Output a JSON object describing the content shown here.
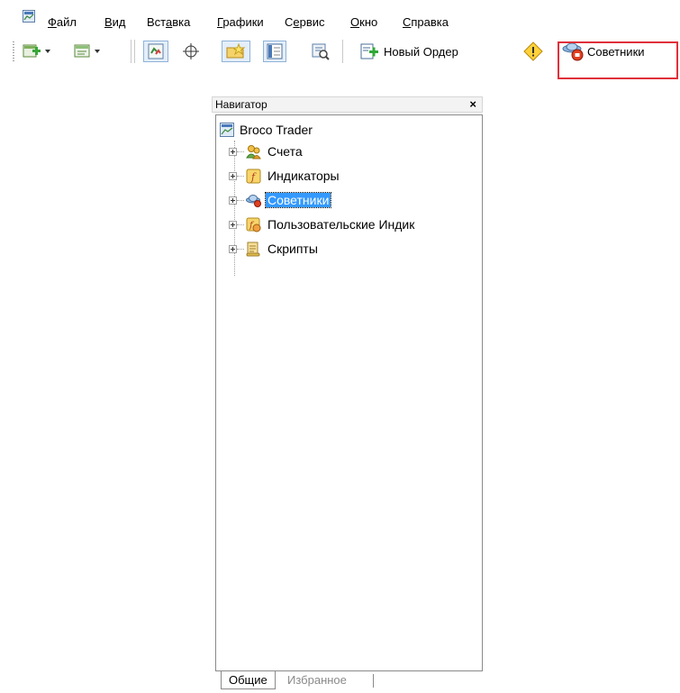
{
  "menu": {
    "items": [
      {
        "label": "Файл",
        "mnemonic": "Ф",
        "rest": "айл"
      },
      {
        "label": "Вид",
        "mnemonic": "В",
        "rest": "ид"
      },
      {
        "label": "Вставка",
        "pre": "Вст",
        "mnemonic": "а",
        "rest": "вка"
      },
      {
        "label": "Графики",
        "mnemonic": "Г",
        "rest": "рафики"
      },
      {
        "label": "Сервис",
        "pre": "С",
        "mnemonic": "е",
        "rest": "рвис"
      },
      {
        "label": "Окно",
        "mnemonic": "О",
        "rest": "кно"
      },
      {
        "label": "Справка",
        "mnemonic": "С",
        "rest": "правка"
      }
    ]
  },
  "toolbar": {
    "new_order_label": "Новый Ордер",
    "experts_label": "Советники"
  },
  "navigator": {
    "title": "Навигатор",
    "close_glyph": "×",
    "root_label": "Broco Trader",
    "items": [
      {
        "label": "Счета",
        "icon": "accounts-icon"
      },
      {
        "label": "Индикаторы",
        "icon": "indicators-icon"
      },
      {
        "label": "Советники",
        "icon": "experts-icon",
        "selected": true
      },
      {
        "label": "Пользовательские Индик",
        "icon": "custom-indicators-icon"
      },
      {
        "label": "Скрипты",
        "icon": "scripts-icon"
      }
    ],
    "tabs": [
      {
        "label": "Общие",
        "active": true
      },
      {
        "label": "Избранное",
        "active": false
      }
    ]
  },
  "colors": {
    "highlight": "#e0303a",
    "selection": "#3399ff"
  }
}
